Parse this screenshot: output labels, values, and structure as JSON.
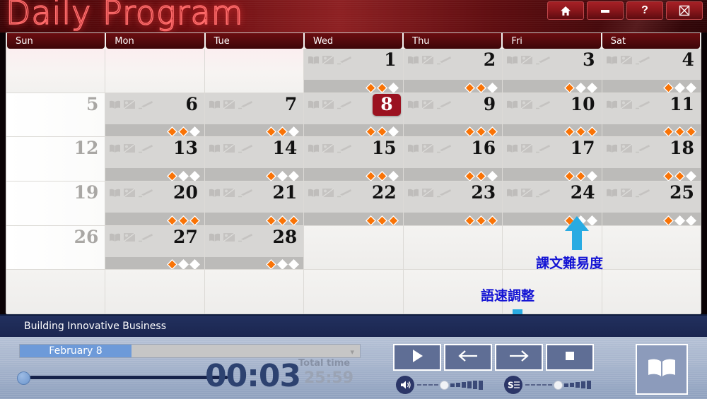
{
  "window": {
    "app_title": "Daily Program",
    "buttons": [
      {
        "name": "home-button",
        "icon": "home-icon"
      },
      {
        "name": "minimize-button",
        "icon": "minimize-icon"
      },
      {
        "name": "help-button",
        "icon": "question-mark-icon",
        "label": "?"
      },
      {
        "name": "close-button",
        "icon": "close-boxed-icon"
      }
    ]
  },
  "calendar": {
    "day_headers": [
      "Sun",
      "Mon",
      "Tue",
      "Wed",
      "Thu",
      "Fri",
      "Sat"
    ],
    "selected_day": 8,
    "cell_icons": [
      "book-icon",
      "picture-card-icon",
      "highlighter-pen-icon"
    ],
    "weeks": [
      [
        {
          "day": "",
          "type": "blank"
        },
        {
          "day": "",
          "type": "blank"
        },
        {
          "day": "",
          "type": "blank"
        },
        {
          "day": "1",
          "type": "lesson",
          "difficulty": 2
        },
        {
          "day": "2",
          "type": "lesson",
          "difficulty": 2
        },
        {
          "day": "3",
          "type": "lesson",
          "difficulty": 1
        },
        {
          "day": "4",
          "type": "lesson",
          "difficulty": 1
        }
      ],
      [
        {
          "day": "5",
          "type": "sunday"
        },
        {
          "day": "6",
          "type": "lesson",
          "difficulty": 2
        },
        {
          "day": "7",
          "type": "lesson",
          "difficulty": 2
        },
        {
          "day": "8",
          "type": "lesson",
          "difficulty": 2,
          "selected": true
        },
        {
          "day": "9",
          "type": "lesson",
          "difficulty": 3
        },
        {
          "day": "10",
          "type": "lesson",
          "difficulty": 3
        },
        {
          "day": "11",
          "type": "lesson",
          "difficulty": 3
        }
      ],
      [
        {
          "day": "12",
          "type": "sunday"
        },
        {
          "day": "13",
          "type": "lesson",
          "difficulty": 1
        },
        {
          "day": "14",
          "type": "lesson",
          "difficulty": 1
        },
        {
          "day": "15",
          "type": "lesson",
          "difficulty": 2
        },
        {
          "day": "16",
          "type": "lesson",
          "difficulty": 2
        },
        {
          "day": "17",
          "type": "lesson",
          "difficulty": 2
        },
        {
          "day": "18",
          "type": "lesson",
          "difficulty": 2
        }
      ],
      [
        {
          "day": "19",
          "type": "sunday"
        },
        {
          "day": "20",
          "type": "lesson",
          "difficulty": 3
        },
        {
          "day": "21",
          "type": "lesson",
          "difficulty": 3
        },
        {
          "day": "22",
          "type": "lesson",
          "difficulty": 3
        },
        {
          "day": "23",
          "type": "lesson",
          "difficulty": 3
        },
        {
          "day": "24",
          "type": "lesson",
          "difficulty": 1
        },
        {
          "day": "25",
          "type": "lesson",
          "difficulty": 1
        }
      ],
      [
        {
          "day": "26",
          "type": "sunday"
        },
        {
          "day": "27",
          "type": "lesson",
          "difficulty": 1
        },
        {
          "day": "28",
          "type": "lesson",
          "difficulty": 1
        },
        {
          "day": "",
          "type": "empty"
        },
        {
          "day": "",
          "type": "empty"
        },
        {
          "day": "",
          "type": "empty"
        },
        {
          "day": "",
          "type": "empty"
        }
      ],
      [
        {
          "day": "",
          "type": "empty"
        },
        {
          "day": "",
          "type": "empty"
        },
        {
          "day": "",
          "type": "empty"
        },
        {
          "day": "",
          "type": "empty"
        },
        {
          "day": "",
          "type": "empty"
        },
        {
          "day": "",
          "type": "empty"
        },
        {
          "day": "",
          "type": "empty"
        }
      ]
    ]
  },
  "annotations": [
    {
      "name": "difficulty-annotation",
      "text": "課文難易度",
      "arrow": "up",
      "color": "#1414d4"
    },
    {
      "name": "speed-annotation",
      "text": "語速調整",
      "arrow": "down",
      "color": "#1414d4"
    }
  ],
  "player": {
    "title": "Building Innovative Business",
    "date_selector_value": "February 8",
    "current_time": "00:03",
    "total_time_label": "Total time",
    "total_time": "25:59",
    "progress_percent": 0,
    "controls": [
      {
        "name": "play-button",
        "icon": "play-icon"
      },
      {
        "name": "previous-button",
        "icon": "arrow-left-icon"
      },
      {
        "name": "next-button",
        "icon": "arrow-right-icon"
      },
      {
        "name": "stop-button",
        "icon": "stop-square-icon"
      }
    ],
    "volume": {
      "name": "volume-slider",
      "icon": "speaker-icon",
      "dashes": 4,
      "bars": 6
    },
    "speed": {
      "name": "speed-slider",
      "icon": "speed-s-icon",
      "dashes": 5,
      "bars": 5
    },
    "book_button": {
      "name": "open-book-button",
      "icon": "open-book-icon"
    }
  },
  "colors": {
    "accent_red": "#8d1a1e",
    "selected_day": "#9b1220",
    "difficulty_filled": "#f97306",
    "annotation_blue": "#1414d4",
    "arrow_cyan": "#29abe2",
    "player_navy": "#22305e"
  }
}
